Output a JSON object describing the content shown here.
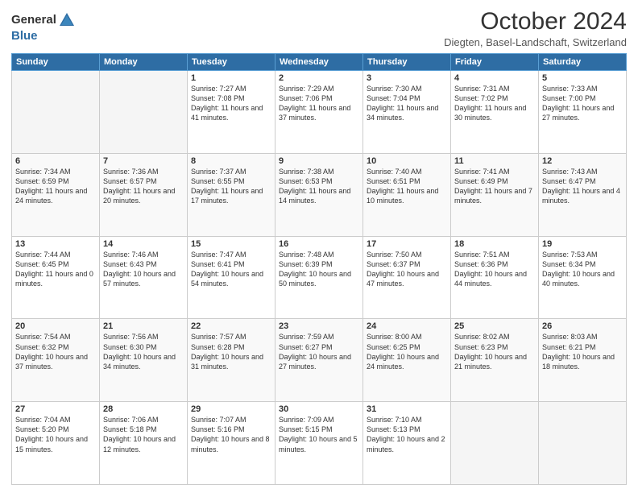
{
  "header": {
    "logo_general": "General",
    "logo_blue": "Blue",
    "title": "October 2024",
    "subtitle": "Diegten, Basel-Landschaft, Switzerland"
  },
  "columns": [
    "Sunday",
    "Monday",
    "Tuesday",
    "Wednesday",
    "Thursday",
    "Friday",
    "Saturday"
  ],
  "weeks": [
    [
      {
        "day": "",
        "empty": true
      },
      {
        "day": "",
        "empty": true
      },
      {
        "day": "1",
        "sunrise": "7:27 AM",
        "sunset": "7:08 PM",
        "daylight": "11 hours and 41 minutes."
      },
      {
        "day": "2",
        "sunrise": "7:29 AM",
        "sunset": "7:06 PM",
        "daylight": "11 hours and 37 minutes."
      },
      {
        "day": "3",
        "sunrise": "7:30 AM",
        "sunset": "7:04 PM",
        "daylight": "11 hours and 34 minutes."
      },
      {
        "day": "4",
        "sunrise": "7:31 AM",
        "sunset": "7:02 PM",
        "daylight": "11 hours and 30 minutes."
      },
      {
        "day": "5",
        "sunrise": "7:33 AM",
        "sunset": "7:00 PM",
        "daylight": "11 hours and 27 minutes."
      }
    ],
    [
      {
        "day": "6",
        "sunrise": "7:34 AM",
        "sunset": "6:59 PM",
        "daylight": "11 hours and 24 minutes."
      },
      {
        "day": "7",
        "sunrise": "7:36 AM",
        "sunset": "6:57 PM",
        "daylight": "11 hours and 20 minutes."
      },
      {
        "day": "8",
        "sunrise": "7:37 AM",
        "sunset": "6:55 PM",
        "daylight": "11 hours and 17 minutes."
      },
      {
        "day": "9",
        "sunrise": "7:38 AM",
        "sunset": "6:53 PM",
        "daylight": "11 hours and 14 minutes."
      },
      {
        "day": "10",
        "sunrise": "7:40 AM",
        "sunset": "6:51 PM",
        "daylight": "11 hours and 10 minutes."
      },
      {
        "day": "11",
        "sunrise": "7:41 AM",
        "sunset": "6:49 PM",
        "daylight": "11 hours and 7 minutes."
      },
      {
        "day": "12",
        "sunrise": "7:43 AM",
        "sunset": "6:47 PM",
        "daylight": "11 hours and 4 minutes."
      }
    ],
    [
      {
        "day": "13",
        "sunrise": "7:44 AM",
        "sunset": "6:45 PM",
        "daylight": "11 hours and 0 minutes."
      },
      {
        "day": "14",
        "sunrise": "7:46 AM",
        "sunset": "6:43 PM",
        "daylight": "10 hours and 57 minutes."
      },
      {
        "day": "15",
        "sunrise": "7:47 AM",
        "sunset": "6:41 PM",
        "daylight": "10 hours and 54 minutes."
      },
      {
        "day": "16",
        "sunrise": "7:48 AM",
        "sunset": "6:39 PM",
        "daylight": "10 hours and 50 minutes."
      },
      {
        "day": "17",
        "sunrise": "7:50 AM",
        "sunset": "6:37 PM",
        "daylight": "10 hours and 47 minutes."
      },
      {
        "day": "18",
        "sunrise": "7:51 AM",
        "sunset": "6:36 PM",
        "daylight": "10 hours and 44 minutes."
      },
      {
        "day": "19",
        "sunrise": "7:53 AM",
        "sunset": "6:34 PM",
        "daylight": "10 hours and 40 minutes."
      }
    ],
    [
      {
        "day": "20",
        "sunrise": "7:54 AM",
        "sunset": "6:32 PM",
        "daylight": "10 hours and 37 minutes."
      },
      {
        "day": "21",
        "sunrise": "7:56 AM",
        "sunset": "6:30 PM",
        "daylight": "10 hours and 34 minutes."
      },
      {
        "day": "22",
        "sunrise": "7:57 AM",
        "sunset": "6:28 PM",
        "daylight": "10 hours and 31 minutes."
      },
      {
        "day": "23",
        "sunrise": "7:59 AM",
        "sunset": "6:27 PM",
        "daylight": "10 hours and 27 minutes."
      },
      {
        "day": "24",
        "sunrise": "8:00 AM",
        "sunset": "6:25 PM",
        "daylight": "10 hours and 24 minutes."
      },
      {
        "day": "25",
        "sunrise": "8:02 AM",
        "sunset": "6:23 PM",
        "daylight": "10 hours and 21 minutes."
      },
      {
        "day": "26",
        "sunrise": "8:03 AM",
        "sunset": "6:21 PM",
        "daylight": "10 hours and 18 minutes."
      }
    ],
    [
      {
        "day": "27",
        "sunrise": "7:04 AM",
        "sunset": "5:20 PM",
        "daylight": "10 hours and 15 minutes."
      },
      {
        "day": "28",
        "sunrise": "7:06 AM",
        "sunset": "5:18 PM",
        "daylight": "10 hours and 12 minutes."
      },
      {
        "day": "29",
        "sunrise": "7:07 AM",
        "sunset": "5:16 PM",
        "daylight": "10 hours and 8 minutes."
      },
      {
        "day": "30",
        "sunrise": "7:09 AM",
        "sunset": "5:15 PM",
        "daylight": "10 hours and 5 minutes."
      },
      {
        "day": "31",
        "sunrise": "7:10 AM",
        "sunset": "5:13 PM",
        "daylight": "10 hours and 2 minutes."
      },
      {
        "day": "",
        "empty": true
      },
      {
        "day": "",
        "empty": true
      }
    ]
  ]
}
